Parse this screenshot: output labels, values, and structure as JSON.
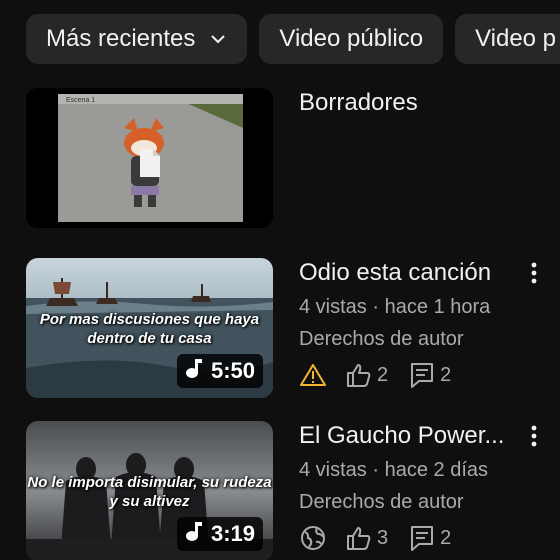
{
  "filters": [
    {
      "label": "Más recientes",
      "has_dropdown": true
    },
    {
      "label": "Video público",
      "has_dropdown": false
    },
    {
      "label": "Video p",
      "has_dropdown": false
    }
  ],
  "drafts": {
    "title": "Borradores",
    "thumb_label": "Escena 1",
    "icon": "document-icon"
  },
  "videos": [
    {
      "title": "Odio esta canción",
      "views": "4 vistas",
      "age": "hace 1 hora",
      "meta_sep": " · ",
      "rights": "Derechos de autor",
      "visibility_icon": "warning-icon",
      "likes": "2",
      "comments": "2",
      "duration": "5:50",
      "thumb_caption": "Por mas discusiones que haya dentro de tu casa"
    },
    {
      "title": "El Gaucho Power...",
      "views": "4 vistas",
      "age": "hace 2 días",
      "meta_sep": " · ",
      "rights": "Derechos de autor",
      "visibility_icon": "globe-icon",
      "likes": "3",
      "comments": "2",
      "duration": "3:19",
      "thumb_caption": "No le importa disimular, su rudeza y su altivez"
    }
  ],
  "colors": {
    "background": "#0f0f0f",
    "chip": "#272727",
    "text_primary": "#f1f1f1",
    "text_secondary": "#aaaaaa",
    "warning": "#f2b530"
  }
}
